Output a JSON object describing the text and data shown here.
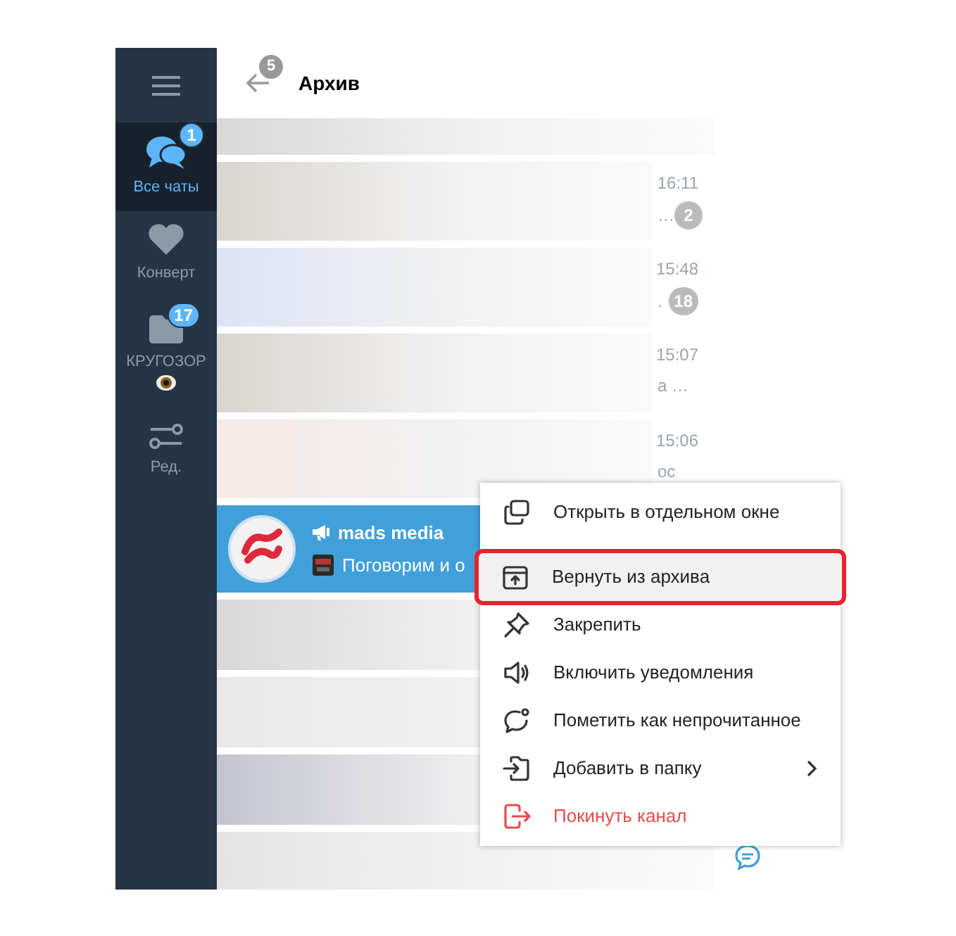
{
  "sidebar": {
    "items": [
      {
        "kind": "chats",
        "label": "Все чаты",
        "badge": "1",
        "selected": true
      },
      {
        "kind": "heart",
        "label": "Конверт",
        "selected": false
      },
      {
        "kind": "folder",
        "label": "КРУГОЗОР",
        "badge": "17",
        "selected": false,
        "emoji": true
      },
      {
        "kind": "edit",
        "label": "Ред.",
        "selected": false
      }
    ]
  },
  "header": {
    "title": "Архив",
    "back_badge": "5"
  },
  "chats": [
    {
      "kind": "banner",
      "color": "#d8d8d8"
    },
    {
      "kind": "blurred",
      "color": "#d9d5d0",
      "time": "16:11",
      "preview": "…",
      "unread": "2"
    },
    {
      "kind": "blurred",
      "color": "#dde3f5",
      "time": "15:48",
      "preview": ".",
      "unread": "18"
    },
    {
      "kind": "blurred",
      "color": "#d9d5d0",
      "time": "15:07",
      "preview": "а …"
    },
    {
      "kind": "blurred",
      "color": "#f6e9e6",
      "time": "15:06",
      "preview": "ос"
    },
    {
      "kind": "channel",
      "name": "mads media",
      "preview": "Поговорим и о",
      "selected": true
    },
    {
      "kind": "blurred",
      "color": "#d8d8d8"
    },
    {
      "kind": "blurred",
      "color": "#e8e8e8"
    },
    {
      "kind": "blurred",
      "color": "#c4c4d0"
    },
    {
      "kind": "blurred",
      "color": "#e4e4e4"
    }
  ],
  "context_menu": {
    "items": [
      {
        "kind": "window",
        "label": "Открыть в отдельном окне",
        "highlighted": false,
        "danger": false,
        "submenu": false
      },
      {
        "kind": "unarchive",
        "label": "Вернуть из архива",
        "highlighted": true,
        "danger": false,
        "submenu": false
      },
      {
        "kind": "pin",
        "label": "Закрепить",
        "highlighted": false,
        "danger": false,
        "submenu": false
      },
      {
        "kind": "sound",
        "label": "Включить уведомления",
        "highlighted": false,
        "danger": false,
        "submenu": false
      },
      {
        "kind": "unread",
        "label": "Пометить как непрочитанное",
        "highlighted": false,
        "danger": false,
        "submenu": false
      },
      {
        "kind": "folder",
        "label": "Добавить в папку",
        "highlighted": false,
        "danger": false,
        "submenu": true
      },
      {
        "kind": "leave",
        "label": "Покинуть канал",
        "highlighted": false,
        "danger": true,
        "submenu": false
      }
    ]
  }
}
